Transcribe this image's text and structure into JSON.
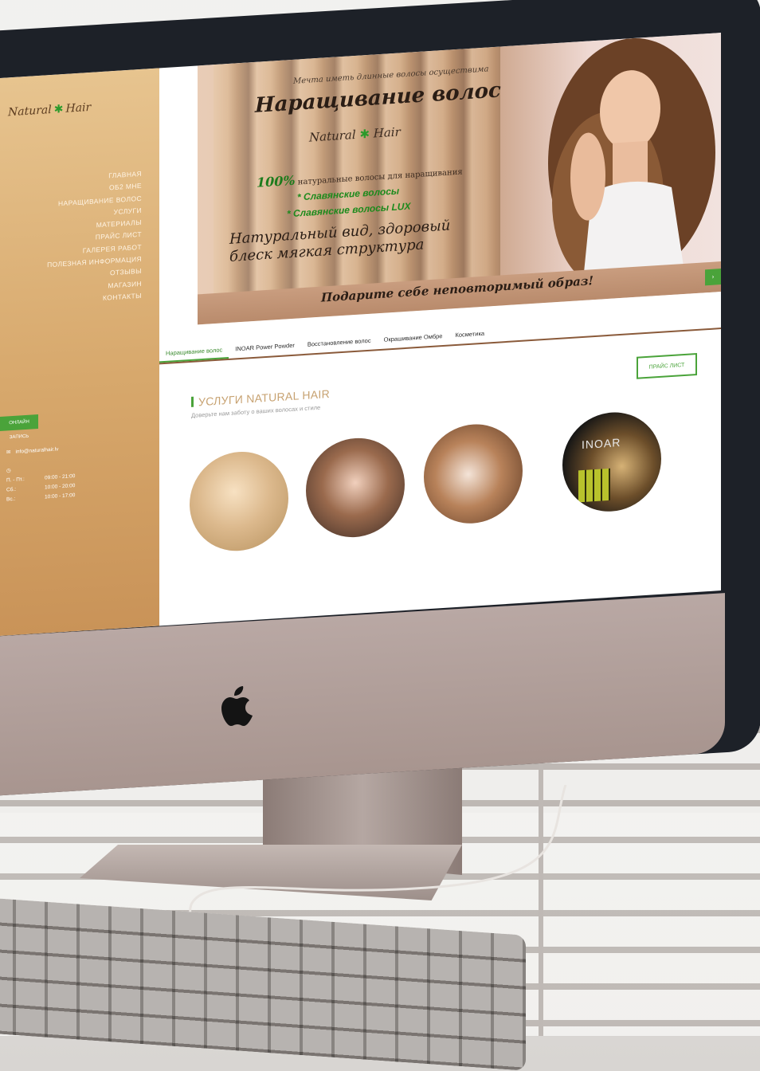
{
  "sidebar": {
    "logo_left": "Natural",
    "logo_right": "Hair",
    "nav": [
      "ГЛАВНАЯ",
      "ОБ2 МНЕ",
      "НАРАЩИВАНИЕ ВОЛОС",
      "УСЛУГИ",
      "МАТЕРИАЛЫ",
      "ПРАЙС ЛИСТ",
      "ГАЛЕРЕЯ РАБОТ",
      "ПОЛЕЗНАЯ ИНФОРМАЦИЯ",
      "ОТЗЫВЫ",
      "МАГАЗИН",
      "КОНТАКТЫ"
    ],
    "cta": "ОНЛАЙН ЗАПИСЬ",
    "email": "info@naturalhair.lv",
    "hours": [
      {
        "day": "П. - Пт.:",
        "time": "09:00 - 21:00"
      },
      {
        "day": "Сб.:",
        "time": "10:00 - 20:00"
      },
      {
        "day": "Вс.:",
        "time": "10:00 - 17:00"
      }
    ]
  },
  "hero": {
    "small_line": "Мечта иметь длинные волосы осуществима",
    "title": "Наращивание волос",
    "logo_left": "Natural",
    "logo_right": "Hair",
    "percent": "100%",
    "percent_text": "натуральные волосы для наращивания",
    "bullet1": "* Славянские волосы",
    "bullet2": "* Славянские волосы LUX",
    "script": "Натуральный вид, здоровый блеск мягкая структура",
    "slogan": "Подарите себе неповторимый образ!",
    "next": "›"
  },
  "tabs": [
    "Наращивание волос",
    "INOAR Power Powder",
    "Восстановление волос",
    "Окрашивание Омбре",
    "Косметика"
  ],
  "services": {
    "title": "УСЛУГИ NATURAL HAIR",
    "subtitle": "Доверьте нам заботу о ваших волосах и стиле",
    "price_button": "ПРАЙС ЛИСТ",
    "inoar_label": "INOAR"
  },
  "colors": {
    "accent_green": "#4aa33a",
    "sidebar_gold": "#d7a86c",
    "title_gold": "#c7a271"
  }
}
